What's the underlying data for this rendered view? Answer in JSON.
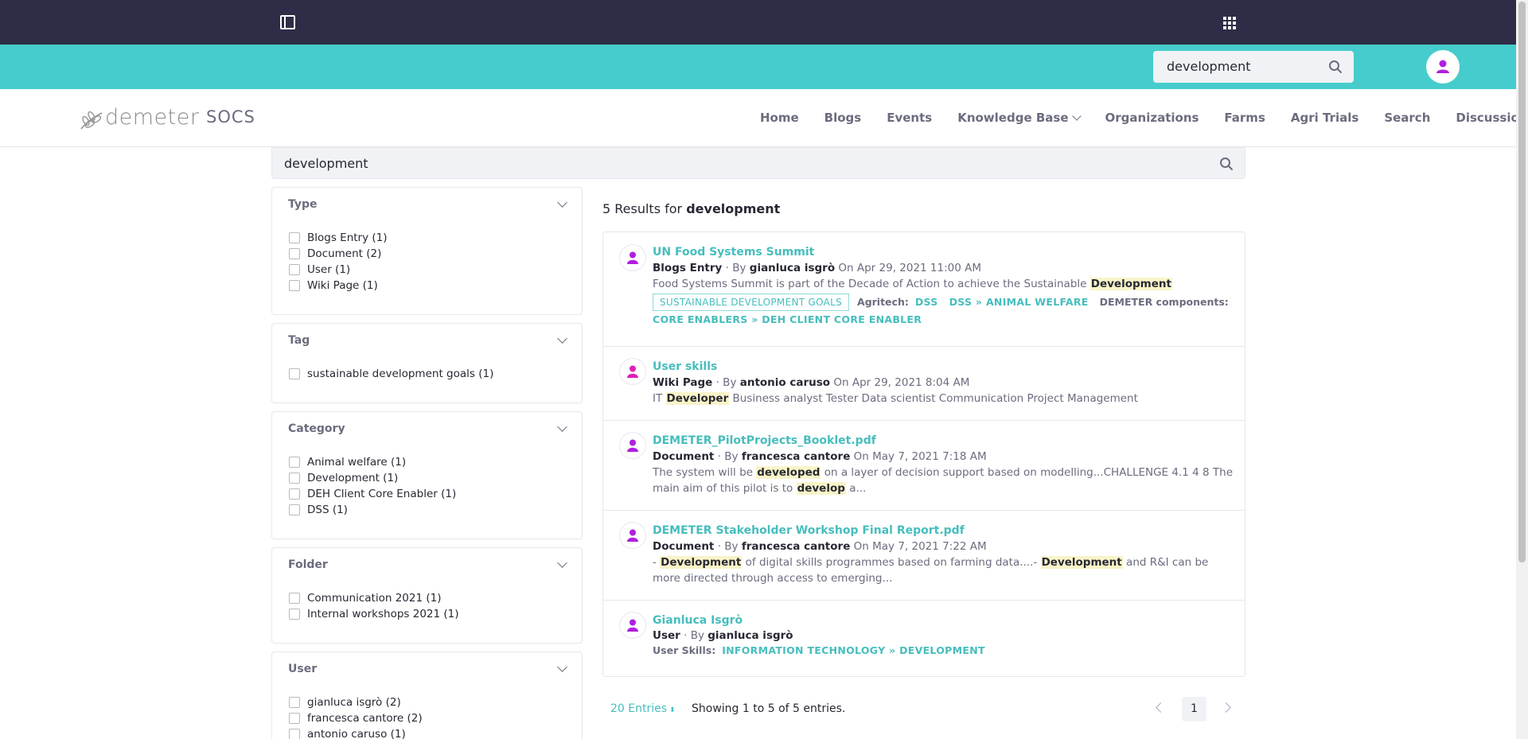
{
  "topbar": {
    "sidebar_toggle_icon": "sidebar-toggle-icon",
    "apps_icon": "apps-grid-icon"
  },
  "header": {
    "search_value": "development",
    "search_icon": "search-icon",
    "avatar_icon": "user-icon"
  },
  "brand": {
    "logo_text": "demeter",
    "site_name": "SOCS"
  },
  "nav": {
    "items": [
      "Home",
      "Blogs",
      "Events",
      "Knowledge Base",
      "Organizations",
      "Farms",
      "Agri Trials",
      "Search",
      "Discussions"
    ]
  },
  "search": {
    "value": "development"
  },
  "facets": [
    {
      "title": "Type",
      "options": [
        "Blogs Entry (1)",
        "Document (2)",
        "User (1)",
        "Wiki Page (1)"
      ]
    },
    {
      "title": "Tag",
      "options": [
        "sustainable development goals (1)"
      ]
    },
    {
      "title": "Category",
      "options": [
        "Animal welfare (1)",
        "Development (1)",
        "DEH Client Core Enabler (1)",
        "DSS (1)"
      ]
    },
    {
      "title": "Folder",
      "options": [
        "Communication 2021 (1)",
        "Internal workshops 2021 (1)"
      ]
    },
    {
      "title": "User",
      "options": [
        "gianluca isgrò (2)",
        "francesca cantore (2)",
        "antonio caruso (1)"
      ]
    }
  ],
  "results": {
    "count_prefix": "5 Results for",
    "query": "development",
    "items": [
      {
        "title": "UN Food Systems Summit",
        "type": "Blogs Entry",
        "by": "· By",
        "author": "gianluca isgrò",
        "date": "On Apr 29, 2021 11:00 AM",
        "desc_before": "Food Systems Summit is part of the Decade of Action to achieve the Sustainable",
        "desc_hl": "Development",
        "desc_after": "",
        "tag": "SUSTAINABLE DEVELOPMENT GOALS",
        "cat1_label": "Agritech:",
        "cat1_a": "DSS",
        "cat1_b": "DSS » ANIMAL WELFARE",
        "cat2_label": "DEMETER components:",
        "cat2_a": "CORE ENABLERS » DEH CLIENT CORE ENABLER"
      },
      {
        "title": "User skills",
        "type": "Wiki Page",
        "by": "· By",
        "author": "antonio caruso",
        "date": "On Apr 29, 2021 8:04 AM",
        "desc_before": "IT",
        "desc_hl": "Developer",
        "desc_after": "Business analyst Tester Data scientist Communication Project Management"
      },
      {
        "title": "DEMETER_PilotProjects_Booklet.pdf",
        "type": "Document",
        "by": "· By",
        "author": "francesca cantore",
        "date": "On May 7, 2021 7:18 AM",
        "desc_before": "The system will be",
        "desc_hl": "developed",
        "desc_mid": "on a layer of decision support based on modelling...CHALLENGE 4.1 4 8 The main aim of this pilot is to",
        "desc_hl2": "develop",
        "desc_after": "a..."
      },
      {
        "title": "DEMETER Stakeholder Workshop Final Report.pdf",
        "type": "Document",
        "by": "· By",
        "author": "francesca cantore",
        "date": "On May 7, 2021 7:22 AM",
        "desc_before": "-",
        "desc_hl": "Development",
        "desc_mid": "of digital skills programmes based on farming data....-",
        "desc_hl2": "Development",
        "desc_after": "and R&I can be more directed through access to emerging..."
      },
      {
        "title": "Gianluca Isgrò",
        "type": "User",
        "by": "· By",
        "author": "gianluca isgrò",
        "skills_label": "User Skills:",
        "skills_value": "INFORMATION TECHNOLOGY » DEVELOPMENT"
      }
    ]
  },
  "pagination": {
    "entries_label": "20 Entries",
    "showing": "Showing 1 to 5 of 5 entries.",
    "current_page": "1"
  },
  "colors": {
    "topbar": "#2e2c46",
    "teal": "#46cccc",
    "link": "#46bdbd",
    "avatar": "#b01fe0",
    "highlight": "#f9f4c8"
  }
}
